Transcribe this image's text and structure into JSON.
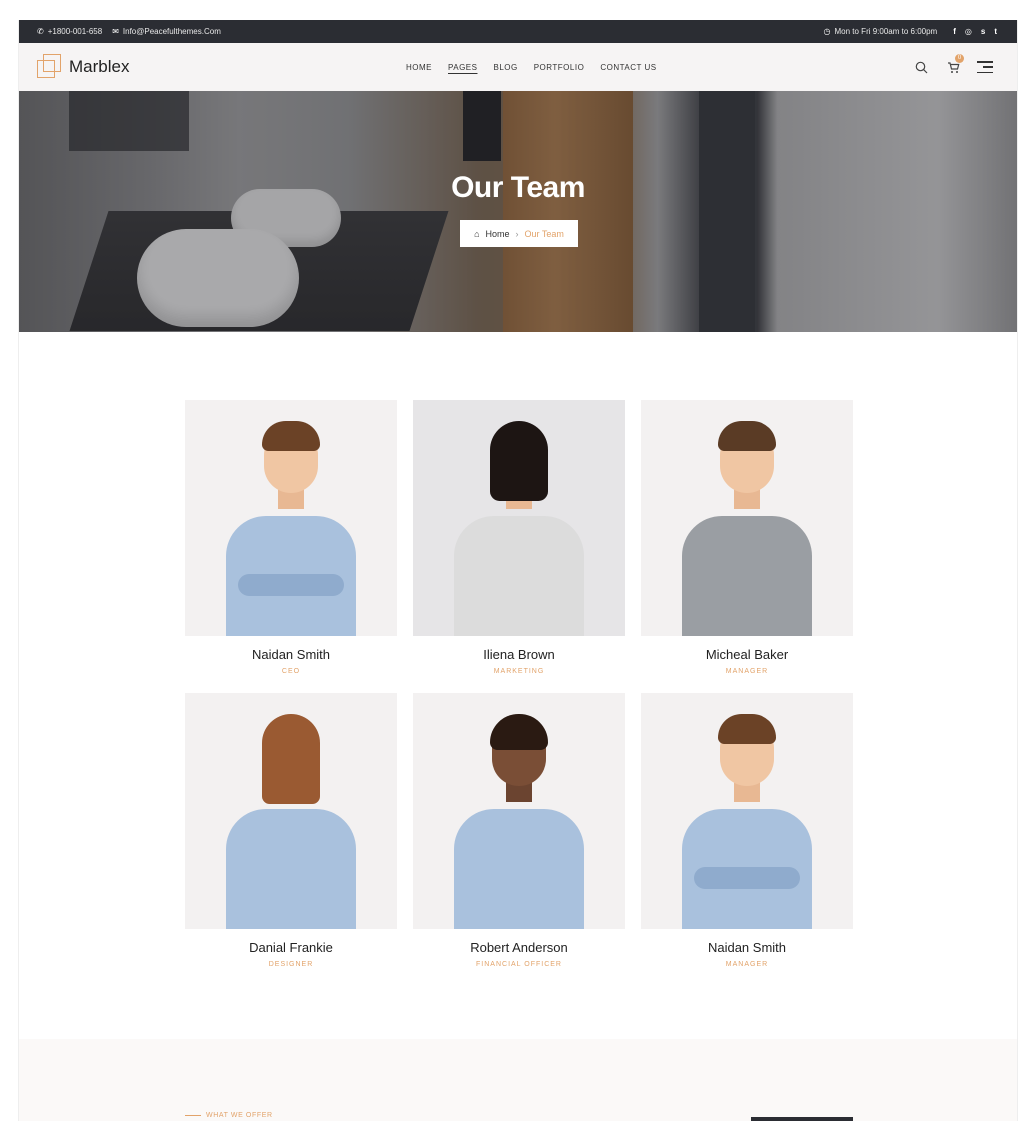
{
  "topbar": {
    "phone": "+1800-001-658",
    "email": "Info@Peacefulthemes.Com",
    "hours": "Mon to Fri 9:00am to 6:00pm",
    "social": [
      "f",
      "◎",
      "s",
      "t"
    ]
  },
  "header": {
    "logo": "Marblex",
    "nav": [
      "HOME",
      "PAGES",
      "BLOG",
      "PORTFOLIO",
      "CONTACT US"
    ],
    "cart_count": "0"
  },
  "hero": {
    "title": "Our Team",
    "crumb_home": "Home",
    "crumb_current": "Our Team"
  },
  "team": [
    {
      "name": "Naidan Smith",
      "role": "CEO"
    },
    {
      "name": "Iliena Brown",
      "role": "MARKETING"
    },
    {
      "name": "Micheal Baker",
      "role": "MANAGER"
    },
    {
      "name": "Danial Frankie",
      "role": "DESIGNER"
    },
    {
      "name": "Robert Anderson",
      "role": "FINANCIAL OFFICER"
    },
    {
      "name": "Naidan Smith",
      "role": "MANAGER"
    }
  ],
  "offer": {
    "tag": "WHAT WE OFFER"
  },
  "colors": {
    "accent": "#e2a36a",
    "dark": "#2b2d33"
  }
}
